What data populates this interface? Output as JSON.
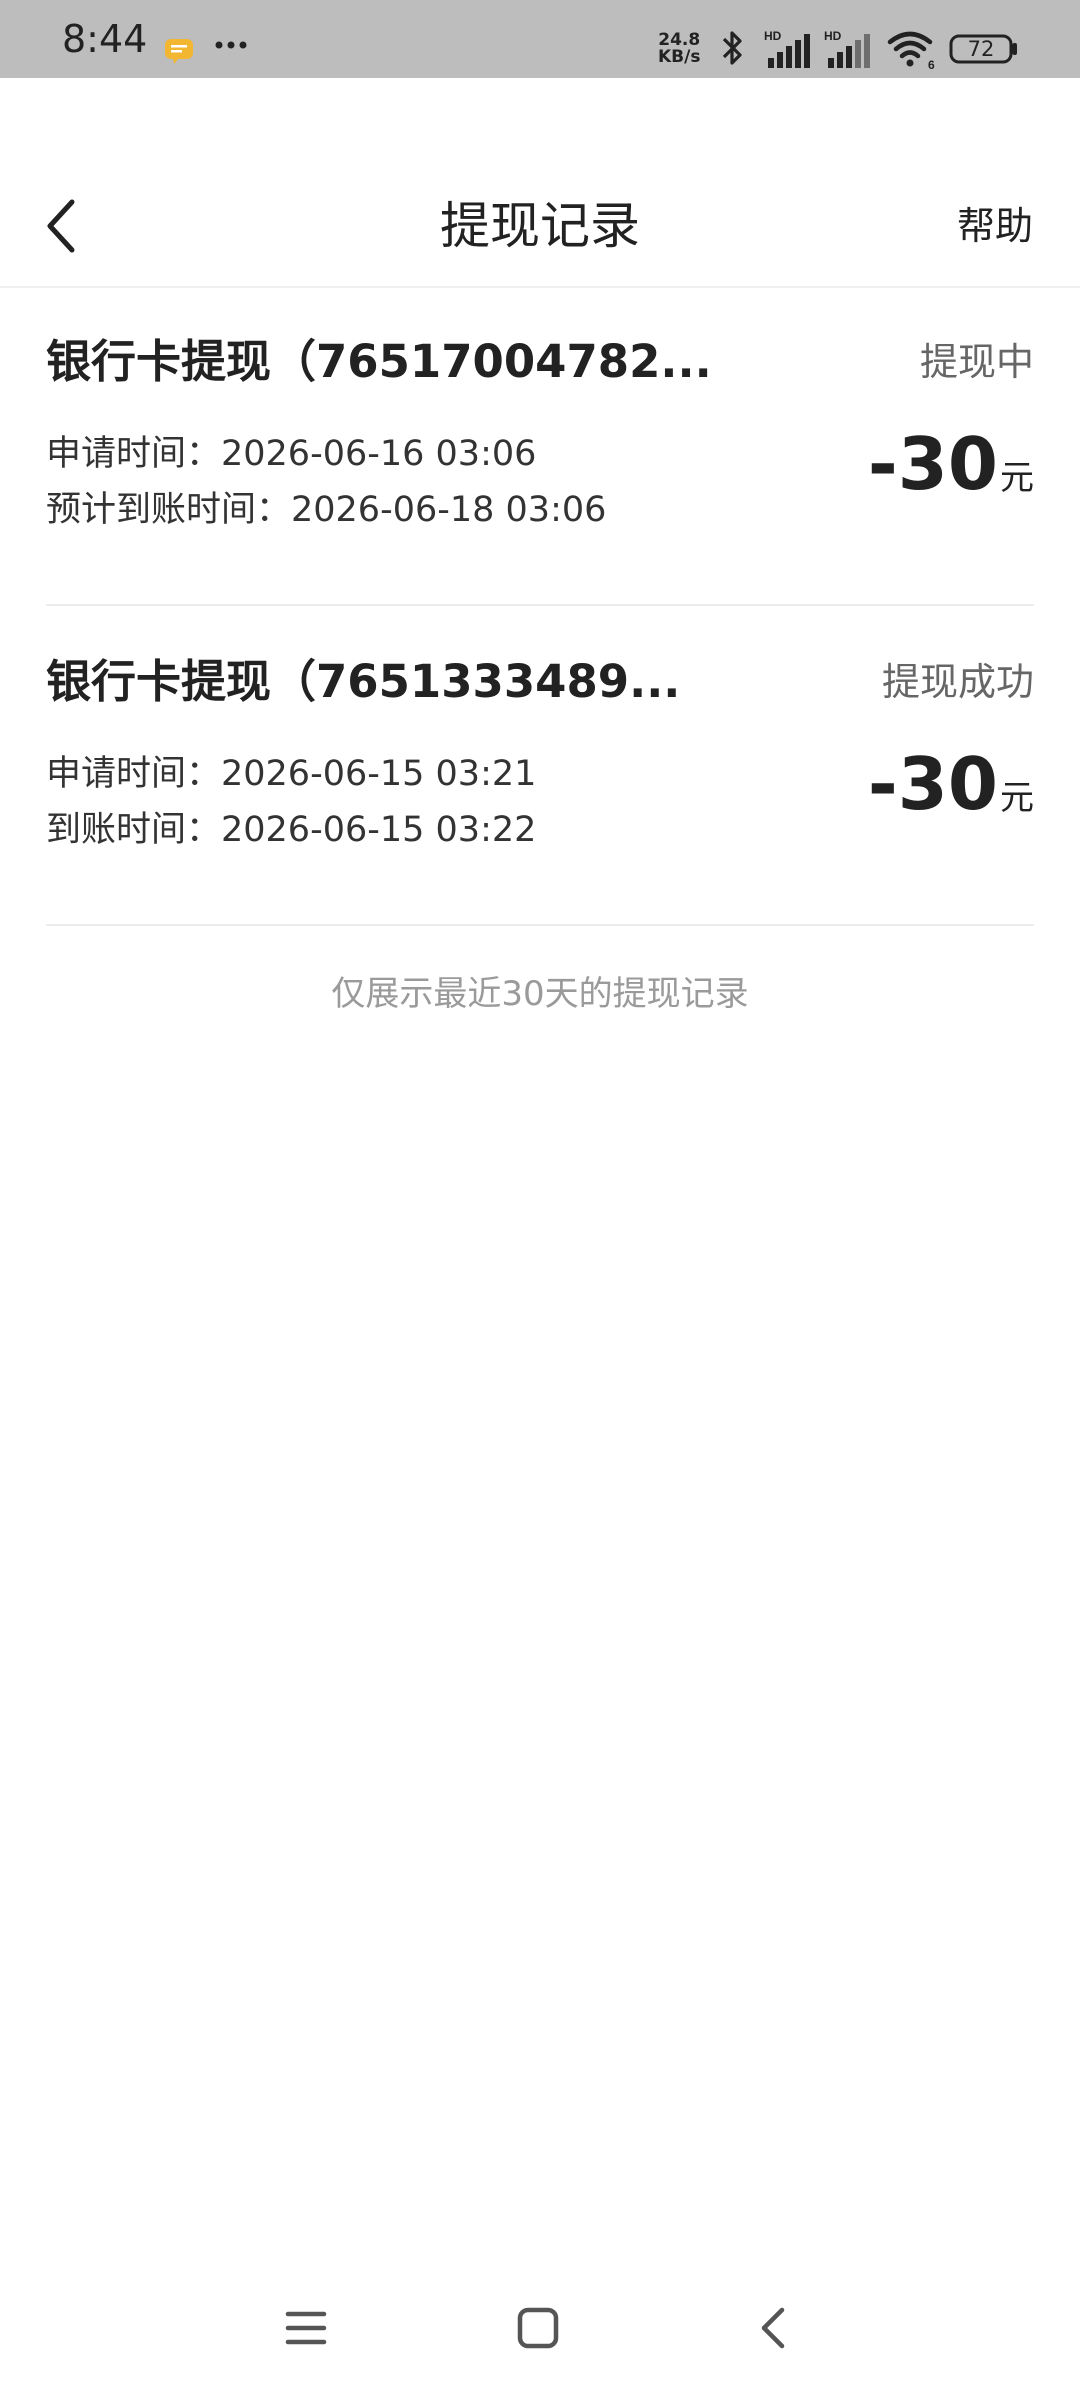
{
  "status_bar": {
    "time": "8:44",
    "net_speed_value": "24.8",
    "net_speed_unit": "KB/s",
    "battery": "72",
    "icons": [
      "message-icon",
      "more-dots-icon",
      "bluetooth-icon",
      "signal-hd-icon",
      "signal-hd-icon",
      "wifi-icon",
      "battery-icon"
    ]
  },
  "header": {
    "title": "提现记录",
    "help_label": "帮助",
    "back_icon": "chevron-left-icon"
  },
  "records": [
    {
      "title": "银行卡提现（76517004782...",
      "status": "提现中",
      "line1": "申请时间：2026-06-16 03:06",
      "line2": "预计到账时间：2026-06-18 03:06",
      "amount": "-30",
      "unit": "元"
    },
    {
      "title": "银行卡提现（7651333489...",
      "status": "提现成功",
      "line1": "申请时间：2026-06-15 03:21",
      "line2": "到账时间：2026-06-15 03:22",
      "amount": "-30",
      "unit": "元"
    }
  ],
  "footer_note": "仅展示最近30天的提现记录",
  "nav_bar": {
    "icons": [
      "menu-icon",
      "home-square-icon",
      "back-triangle-icon"
    ]
  },
  "colors": {
    "status_bar_bg": "#bdbdbd",
    "text_primary": "#222222",
    "text_secondary": "#666666",
    "note_gray": "#9a9a9a",
    "divider": "#ededed"
  }
}
